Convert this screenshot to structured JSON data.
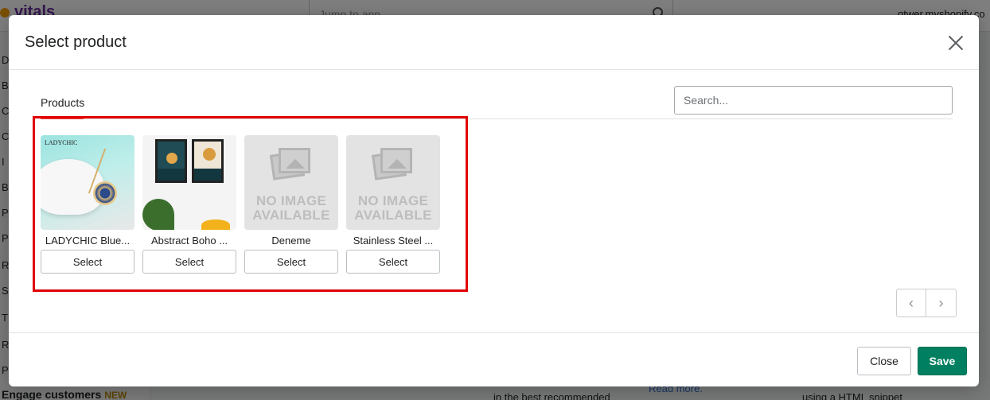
{
  "background": {
    "logo": "vitals",
    "jump_placeholder": "Jump to app",
    "shop_domain": "qtwer.myshopify.co",
    "sidebar_letters": [
      "D",
      "B",
      "C",
      "C",
      "I",
      "B",
      "P",
      "P",
      "R",
      "S",
      "T",
      "R",
      "P"
    ],
    "engage": "Engage customers",
    "engage_badge": "NEW",
    "footer_text_1": "in the best recommended",
    "footer_link": "Read more.",
    "footer_text_2": "using a HTML snippet"
  },
  "modal": {
    "title": "Select product",
    "tab_label": "Products",
    "search_placeholder": "Search...",
    "products": [
      {
        "name": "LADYCHIC Blue...",
        "image": "jewelry-photo",
        "brand_text": "LADYCHIC",
        "select_label": "Select"
      },
      {
        "name": "Abstract Boho ...",
        "image": "wall-art-photo",
        "select_label": "Select"
      },
      {
        "name": "Deneme",
        "image": "no-image",
        "placeholder_text": "NO IMAGE AVAILABLE",
        "select_label": "Select"
      },
      {
        "name": "Stainless Steel ...",
        "image": "no-image",
        "placeholder_text": "NO IMAGE AVAILABLE",
        "select_label": "Select"
      }
    ],
    "pager": {
      "prev_icon": "‹",
      "next_icon": "›"
    },
    "close_label": "Close",
    "save_label": "Save"
  },
  "colors": {
    "primary": "#008060",
    "highlight": "#e00000",
    "tab_underline": "#e14b4b"
  }
}
